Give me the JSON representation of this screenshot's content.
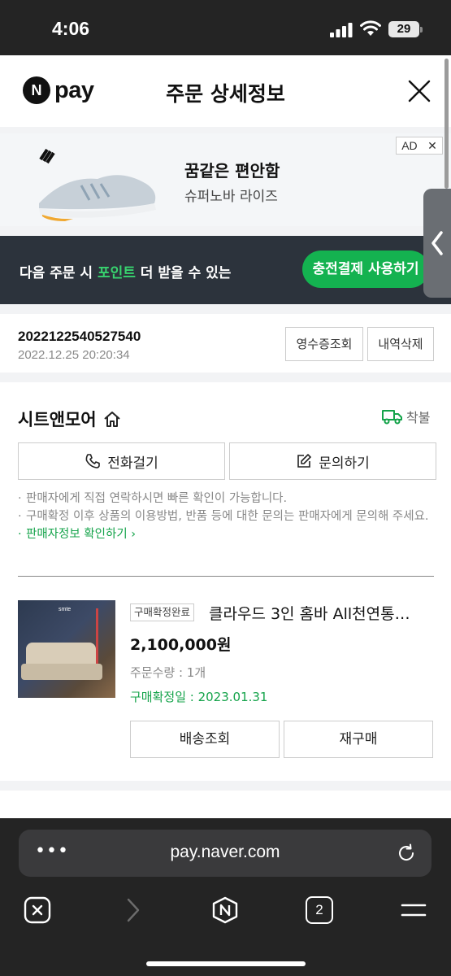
{
  "status_bar": {
    "time": "4:06",
    "battery": "29"
  },
  "header": {
    "logo_text": "pay",
    "logo_badge": "N",
    "title": "주문 상세정보"
  },
  "ad": {
    "headline": "꿈같은 편안함",
    "sub": "슈퍼노바 라이즈",
    "ad_label": "AD",
    "ad_close": "✕"
  },
  "promo": {
    "text_before": "다음 주문 시 ",
    "text_highlight": "포인트",
    "text_after": " 더 받을 수 있는",
    "button": "충전결제 사용하기"
  },
  "order": {
    "number": "2022122540527540",
    "date": "2022.12.25 20:20:34",
    "receipt_button": "영수증조회",
    "delete_button": "내역삭제"
  },
  "store": {
    "name": "시트앤모어",
    "cod_label": "착불",
    "call_button": "전화걸기",
    "inquiry_button": "문의하기",
    "notes": [
      "판매자에게 직접 연락하시면 빠른 확인이 가능합니다.",
      "구매확정 이후 상품의 이용방법, 반품 등에 대한 문의는 판매자에게 문의해 주세요."
    ],
    "seller_link": "판매자정보 확인하기"
  },
  "product": {
    "status_tag": "구매확정완료",
    "name": "클라우드 3인 홈바 All천연통…",
    "price": "2,100,000원",
    "quantity": "주문수량 : 1개",
    "confirm_date": "구매확정일 : 2023.01.31",
    "ship_button": "배송조회",
    "rebuy_button": "재구매"
  },
  "browser": {
    "url": "pay.naver.com",
    "tab_count": "2"
  }
}
